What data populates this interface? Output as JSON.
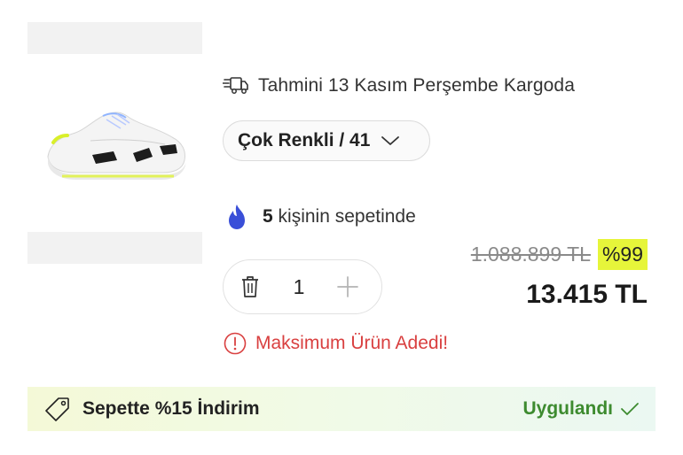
{
  "delivery": {
    "icon": "truck-icon",
    "text": "Tahmini 13 Kasım Perşembe Kargoda"
  },
  "variant": {
    "label": "Çok Renkli / 41",
    "icon": "chevron-down-icon"
  },
  "social_proof": {
    "icon": "fire-icon",
    "count": "5",
    "text": " kişinin sepetinde"
  },
  "pricing": {
    "old_price": "1.088.899 TL",
    "discount": "%99",
    "price": "13.415 TL",
    "badge_color": "#e6f53a"
  },
  "quantity": {
    "value": "1",
    "remove_icon": "trash-icon",
    "add_icon": "plus-icon"
  },
  "warning": {
    "icon": "info-circle-icon",
    "text": "Maksimum Ürün Adedi!",
    "color": "#d94040"
  },
  "coupon": {
    "icon": "tag-icon",
    "text": "Sepette %15 İndirim",
    "status": "Uygulandı",
    "status_icon": "check-icon",
    "status_color": "#3d8b2f"
  },
  "colors": {
    "accent_blue": "#3a4fd8"
  }
}
